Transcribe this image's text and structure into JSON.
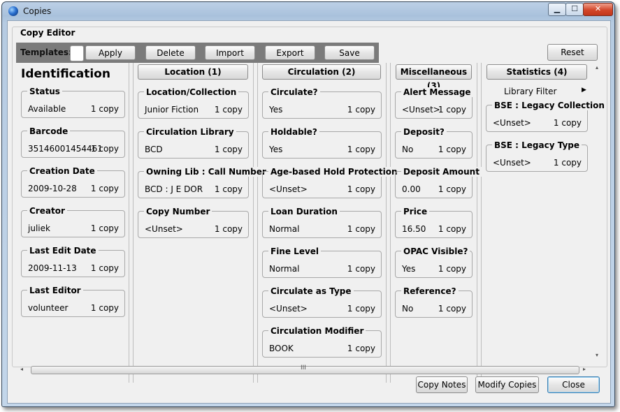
{
  "window": {
    "title": "Copies",
    "controls": {
      "minimize": "▁",
      "maximize": "☐",
      "close": "✕"
    }
  },
  "editor": {
    "legend": "Copy Editor"
  },
  "toolbar": {
    "templates_label": "Templates:",
    "apply": "Apply",
    "delete": "Delete",
    "import": "Import",
    "export": "Export",
    "save": "Save",
    "reset": "Reset"
  },
  "identification": {
    "title": "Identification",
    "fields": [
      {
        "label": "Status",
        "value": "Available",
        "count": "1 copy"
      },
      {
        "label": "Barcode",
        "value": "35146001454461",
        "count": "1 copy"
      },
      {
        "label": "Creation Date",
        "value": "2009-10-28",
        "count": "1 copy"
      },
      {
        "label": "Creator",
        "value": "juliek",
        "count": "1 copy"
      },
      {
        "label": "Last Edit Date",
        "value": "2009-11-13",
        "count": "1 copy"
      },
      {
        "label": "Last Editor",
        "value": "volunteer",
        "count": "1 copy"
      }
    ]
  },
  "location": {
    "header": "Location (1)",
    "fields": [
      {
        "label": "Location/Collection",
        "value": "Junior Fiction",
        "count": "1 copy"
      },
      {
        "label": "Circulation Library",
        "value": "BCD",
        "count": "1 copy"
      },
      {
        "label": "Owning Lib : Call Number",
        "value": "BCD : J E DOR",
        "count": "1 copy"
      },
      {
        "label": "Copy Number",
        "value": "<Unset>",
        "count": "1 copy"
      }
    ]
  },
  "circulation": {
    "header": "Circulation (2)",
    "fields": [
      {
        "label": "Circulate?",
        "value": "Yes",
        "count": "1 copy"
      },
      {
        "label": "Holdable?",
        "value": "Yes",
        "count": "1 copy"
      },
      {
        "label": "Age-based Hold Protection",
        "value": "<Unset>",
        "count": "1 copy"
      },
      {
        "label": "Loan Duration",
        "value": "Normal",
        "count": "1 copy"
      },
      {
        "label": "Fine Level",
        "value": "Normal",
        "count": "1 copy"
      },
      {
        "label": "Circulate as Type",
        "value": "<Unset>",
        "count": "1 copy"
      },
      {
        "label": "Circulation Modifier",
        "value": "BOOK",
        "count": "1 copy"
      }
    ]
  },
  "miscellaneous": {
    "header": "Miscellaneous (3)",
    "fields": [
      {
        "label": "Alert Message",
        "value": "<Unset>",
        "count": "1 copy"
      },
      {
        "label": "Deposit?",
        "value": "No",
        "count": "1 copy"
      },
      {
        "label": "Deposit Amount",
        "value": "0.00",
        "count": "1 copy"
      },
      {
        "label": "Price",
        "value": "16.50",
        "count": "1 copy"
      },
      {
        "label": "OPAC Visible?",
        "value": "Yes",
        "count": "1 copy"
      },
      {
        "label": "Reference?",
        "value": "No",
        "count": "1 copy"
      }
    ]
  },
  "statistics": {
    "header": "Statistics (4)",
    "library_filter": "Library Filter",
    "fields": [
      {
        "label": "BSE : Legacy Collection",
        "value": "<Unset>",
        "count": "1 copy"
      },
      {
        "label": "BSE : Legacy Type",
        "value": "<Unset>",
        "count": "1 copy"
      }
    ]
  },
  "footer": {
    "copy_notes": "Copy Notes",
    "modify_copies": "Modify Copies",
    "close": "Close"
  },
  "scroll": {
    "grip": "III",
    "left": "◂",
    "right": "▸",
    "up": "▴",
    "down": "▾"
  }
}
